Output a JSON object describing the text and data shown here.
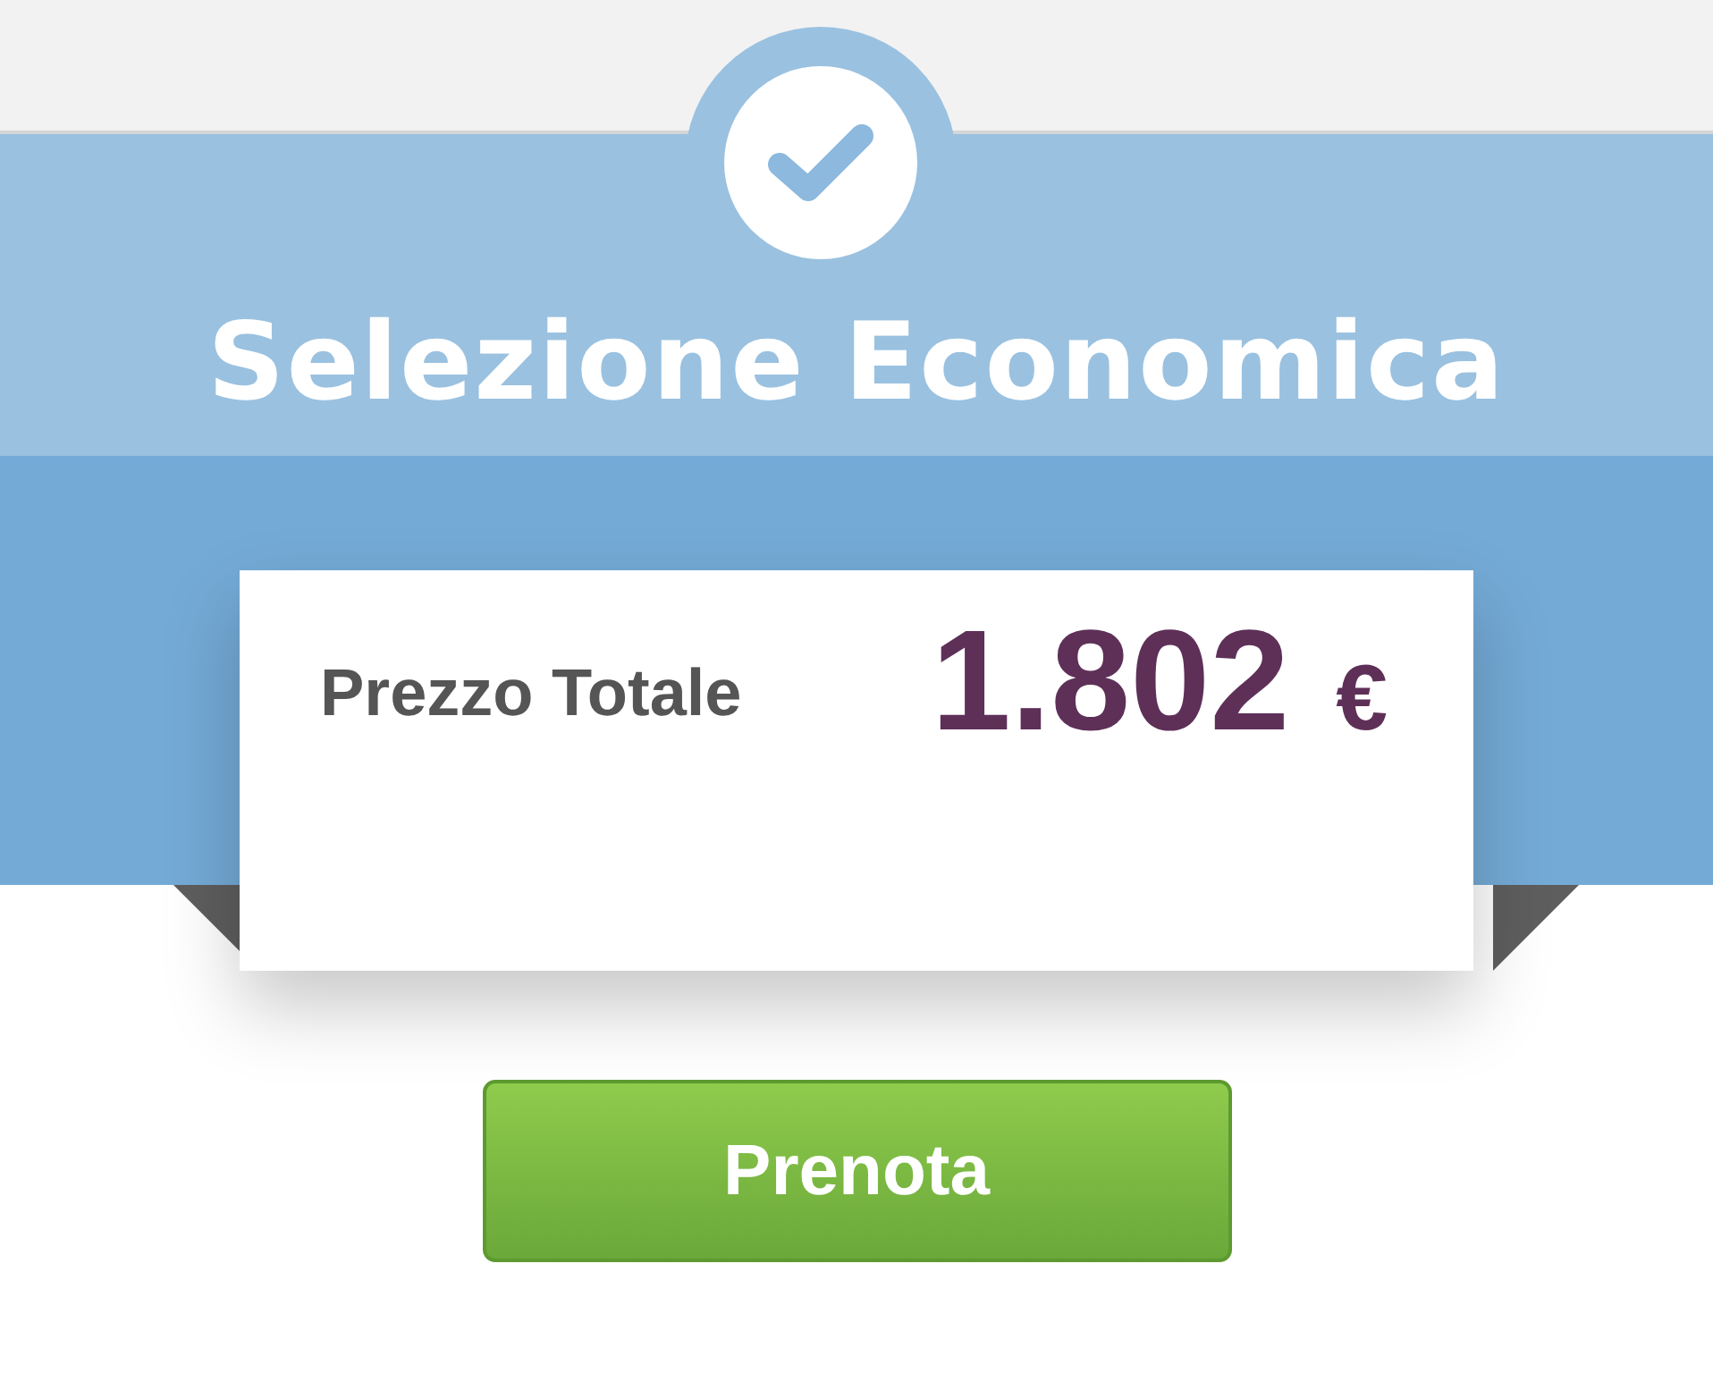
{
  "header": {
    "title": "Selezione Economica"
  },
  "price_card": {
    "label": "Prezzo Totale",
    "price": "1.802",
    "currency": "€"
  },
  "button": {
    "label": "Prenota"
  }
}
